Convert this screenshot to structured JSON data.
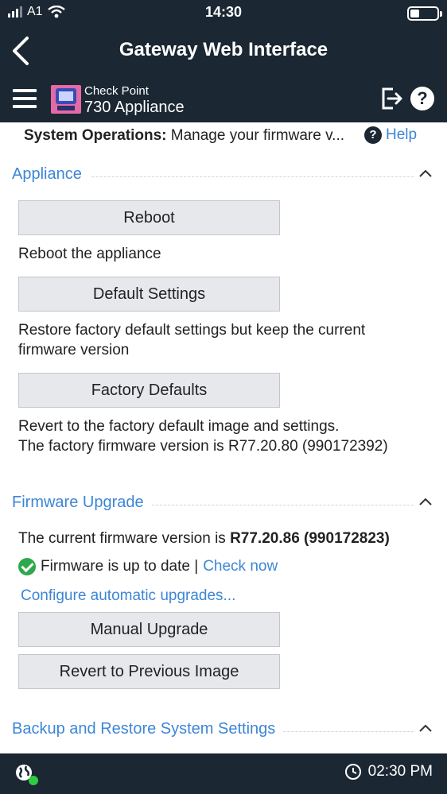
{
  "status_bar": {
    "carrier": "A1",
    "time": "14:30",
    "battery_level": 0.35
  },
  "title_bar": {
    "title": "Gateway Web Interface"
  },
  "app_header": {
    "brand_top": "Check Point",
    "brand_bottom": "730 Appliance"
  },
  "page": {
    "label": "System Operations:",
    "description": "Manage your firmware v...",
    "help_label": "Help"
  },
  "appliance": {
    "title": "Appliance",
    "reboot_label": "Reboot",
    "reboot_desc": "Reboot the appliance",
    "default_settings_label": "Default Settings",
    "default_settings_desc_line1": "Restore factory default settings but keep the current",
    "default_settings_desc_line2": "firmware version",
    "factory_defaults_label": "Factory Defaults",
    "factory_defaults_desc_line1": "Revert to the factory default image and settings.",
    "factory_defaults_desc_line2": "The factory firmware version is R77.20.80 (990172392)"
  },
  "firmware": {
    "title": "Firmware Upgrade",
    "current_prefix": "The current firmware version is",
    "current_version": "R77.20.86 (990172823)",
    "status_text": "Firmware is up to date |",
    "check_now": "Check now",
    "configure_link": "Configure automatic upgrades...",
    "manual_upgrade_label": "Manual Upgrade",
    "revert_label": "Revert to Previous Image"
  },
  "backup": {
    "title": "Backup and Restore System Settings"
  },
  "footer": {
    "time": "02:30 PM"
  },
  "colors": {
    "dark_bar": "#1b2733",
    "link_blue": "#3d86d6",
    "ok_green": "#2ea84c",
    "button_bg": "#e6e8eb"
  }
}
